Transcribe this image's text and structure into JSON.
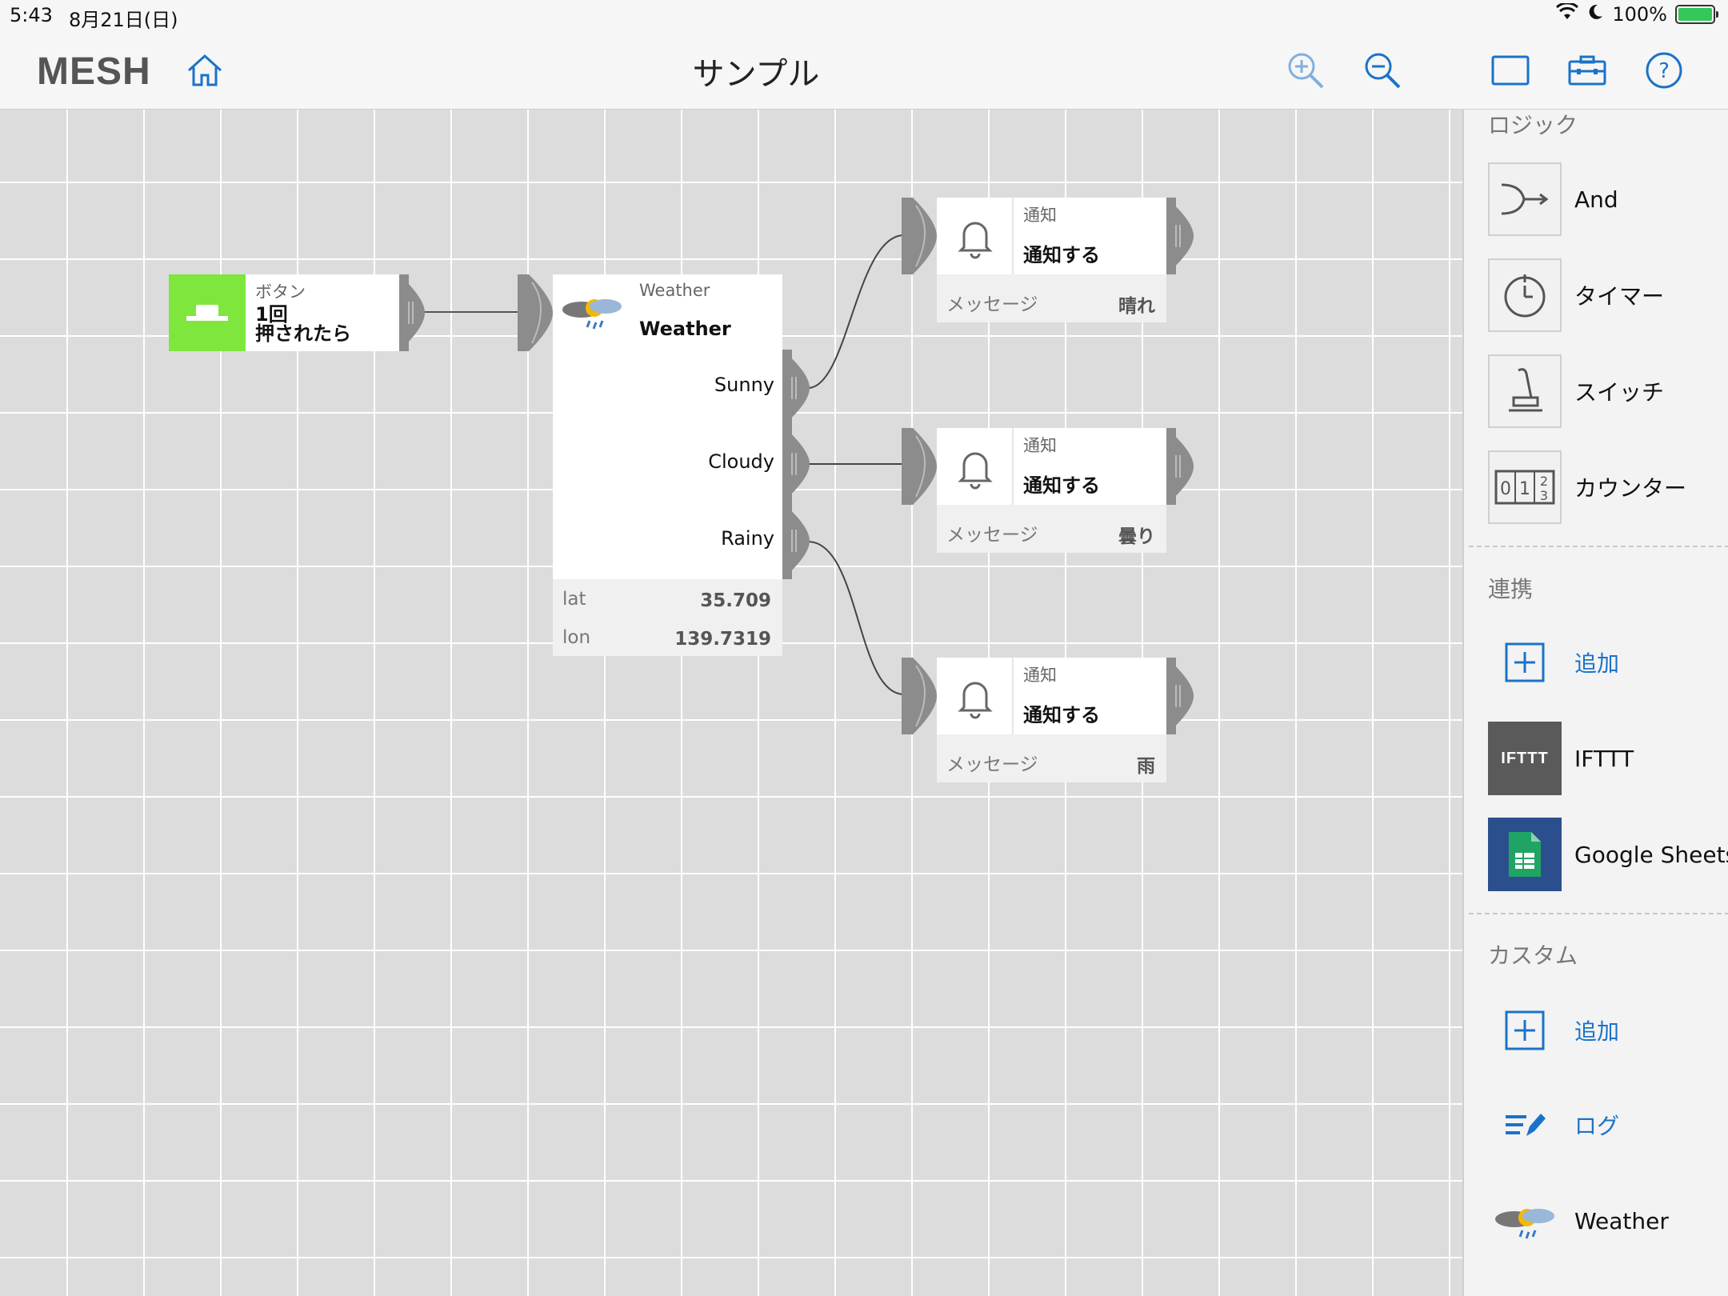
{
  "status_bar": {
    "time": "5:43",
    "date": "8月21日(日)",
    "battery": "100%"
  },
  "nav": {
    "logo": "MESH",
    "title": "サンプル"
  },
  "canvas": {
    "button_block": {
      "category": "ボタン",
      "line1": "1回",
      "line2": "押されたら",
      "accent": "#7ee63d"
    },
    "weather_block": {
      "category": "Weather",
      "name": "Weather",
      "outputs": [
        "Sunny",
        "Cloudy",
        "Rainy"
      ],
      "params": [
        {
          "key": "lat",
          "value": "35.709"
        },
        {
          "key": "lon",
          "value": "139.7319"
        }
      ]
    },
    "notify_blocks": [
      {
        "category": "通知",
        "action": "通知する",
        "param_label": "メッセージ",
        "param_value": "晴れ"
      },
      {
        "category": "通知",
        "action": "通知する",
        "param_label": "メッセージ",
        "param_value": "曇り"
      },
      {
        "category": "通知",
        "action": "通知する",
        "param_label": "メッセージ",
        "param_value": "雨"
      }
    ]
  },
  "panel": {
    "logic": {
      "title": "ロジック",
      "items": [
        {
          "label": "And",
          "icon": "and-icon"
        },
        {
          "label": "タイマー",
          "icon": "timer-icon"
        },
        {
          "label": "スイッチ",
          "icon": "switch-icon"
        },
        {
          "label": "カウンター",
          "icon": "counter-icon"
        }
      ]
    },
    "integration": {
      "title": "連携",
      "add_label": "追加",
      "items": [
        {
          "label": "IFTTT",
          "tile_text": "IFTTT"
        },
        {
          "label": "Google Sheets"
        }
      ]
    },
    "custom": {
      "title": "カスタム",
      "add_label": "追加",
      "items": [
        {
          "label": "ログ"
        },
        {
          "label": "Weather"
        }
      ]
    }
  },
  "colors": {
    "accent_blue": "#1a73c9",
    "button_green": "#7ee63d",
    "connector_gray": "#8c8c8c"
  }
}
